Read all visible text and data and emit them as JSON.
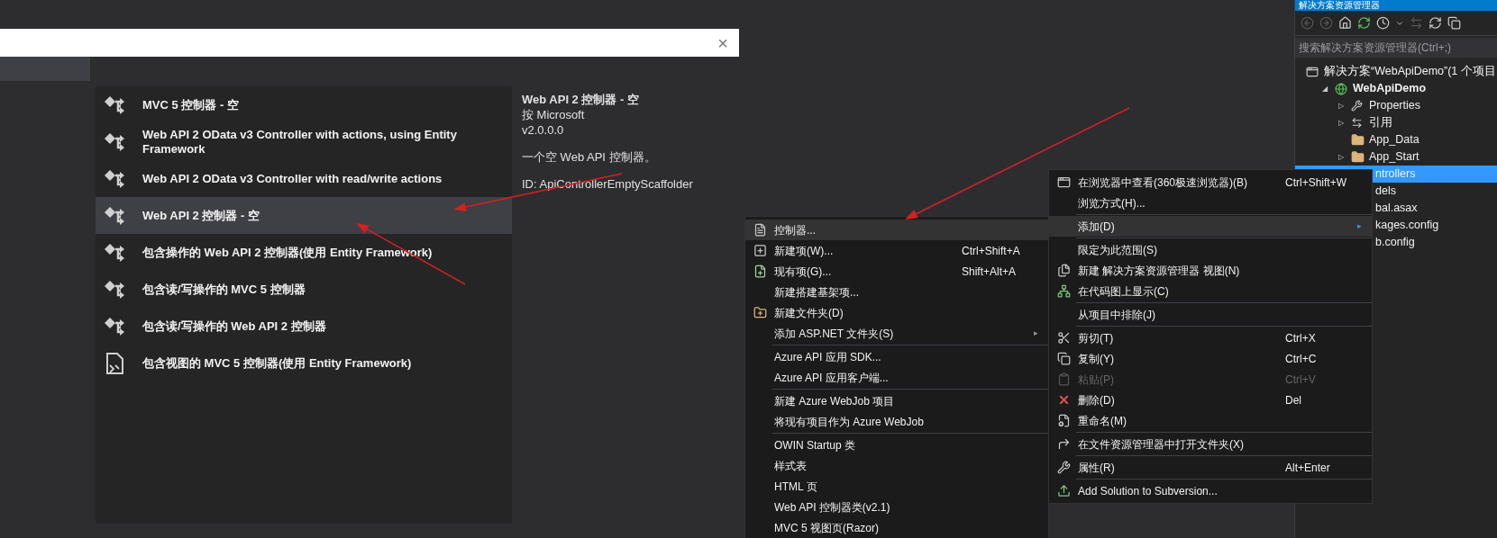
{
  "dialog": {
    "close": "×",
    "templates": [
      {
        "kind": "controller",
        "label": "MVC 5 控制器 - 空",
        "selected": false
      },
      {
        "kind": "controller",
        "label": "Web API 2 OData v3 Controller with actions, using Entity Framework",
        "selected": false
      },
      {
        "kind": "controller",
        "label": "Web API 2 OData v3 Controller with read/write actions",
        "selected": false
      },
      {
        "kind": "controller",
        "label": "Web API 2 控制器 - 空",
        "selected": true
      },
      {
        "kind": "controller",
        "label": "包含操作的 Web API 2 控制器(使用 Entity Framework)",
        "selected": false
      },
      {
        "kind": "controller",
        "label": "包含读/写操作的 MVC 5 控制器",
        "selected": false
      },
      {
        "kind": "controller",
        "label": "包含读/写操作的 Web API 2 控制器",
        "selected": false
      },
      {
        "kind": "document",
        "label": "包含视图的 MVC 5 控制器(使用 Entity Framework)",
        "selected": false
      }
    ],
    "details": {
      "title": "Web API 2 控制器 - 空",
      "publisher": "按 Microsoft",
      "version": "v2.0.0.0",
      "description": "一个空 Web API 控制器。",
      "id": "ID: ApiControllerEmptyScaffolder"
    }
  },
  "solution_explorer": {
    "title": "解决方案资源管理器",
    "search": {
      "placeholder": "搜索解决方案资源管理器(Ctrl+;)"
    },
    "tree": [
      {
        "kind": "solution",
        "label": "解决方案“WebApiDemo”(1 个项目",
        "children": [
          {
            "kind": "project",
            "label": "WebApiDemo",
            "expander": "◢",
            "children": [
              {
                "kind": "properties",
                "label": "Properties",
                "expander": "▷",
                "selected": false
              },
              {
                "kind": "references",
                "label": "引用",
                "expander": "▷",
                "selected": false
              },
              {
                "kind": "folder",
                "label": "App_Data",
                "selected": false
              },
              {
                "kind": "folder",
                "label": "App_Start",
                "expander": "▷",
                "selected": false
              },
              {
                "kind": "covered",
                "label": "ntrollers",
                "selected": true
              },
              {
                "kind": "covered",
                "label": "dels",
                "selected": false
              },
              {
                "kind": "covered",
                "label": "bal.asax",
                "selected": false
              },
              {
                "kind": "covered",
                "label": "kages.config",
                "selected": false
              },
              {
                "kind": "covered",
                "label": "b.config",
                "selected": false
              }
            ]
          }
        ]
      }
    ]
  },
  "context_menu": {
    "items": [
      {
        "kind": "item",
        "label": "在浏览器中查看(360极速浏览器)(B)",
        "shortcut": "Ctrl+Shift+W",
        "selected": false,
        "disabled": false
      },
      {
        "kind": "item",
        "label": "浏览方式(H)...",
        "selected": false,
        "disabled": false
      },
      {
        "kind": "separator"
      },
      {
        "kind": "item",
        "label": "添加(D)",
        "submenu_arrow": "▸",
        "selected": true,
        "disabled": false
      },
      {
        "kind": "separator"
      },
      {
        "kind": "item",
        "label": "限定为此范围(S)",
        "selected": false,
        "disabled": false
      },
      {
        "kind": "item",
        "label": "新建 解决方案资源管理器 视图(N)",
        "selected": false,
        "disabled": false
      },
      {
        "kind": "item",
        "label": "在代码图上显示(C)",
        "selected": false,
        "disabled": false
      },
      {
        "kind": "separator"
      },
      {
        "kind": "item",
        "label": "从项目中排除(J)",
        "selected": false,
        "disabled": false
      },
      {
        "kind": "separator"
      },
      {
        "kind": "item",
        "label": "剪切(T)",
        "shortcut": "Ctrl+X",
        "selected": false,
        "disabled": false
      },
      {
        "kind": "item",
        "label": "复制(Y)",
        "shortcut": "Ctrl+C",
        "selected": false,
        "disabled": false
      },
      {
        "kind": "item",
        "label": "粘贴(P)",
        "shortcut": "Ctrl+V",
        "selected": false,
        "disabled": true
      },
      {
        "kind": "item",
        "label": "删除(D)",
        "shortcut": "Del",
        "selected": false,
        "disabled": false
      },
      {
        "kind": "item",
        "label": "重命名(M)",
        "selected": false,
        "disabled": false
      },
      {
        "kind": "separator"
      },
      {
        "kind": "item",
        "label": "在文件资源管理器中打开文件夹(X)",
        "selected": false,
        "disabled": false
      },
      {
        "kind": "separator"
      },
      {
        "kind": "item",
        "label": "属性(R)",
        "shortcut": "Alt+Enter",
        "selected": false,
        "disabled": false
      },
      {
        "kind": "separator"
      },
      {
        "kind": "item",
        "label": "Add Solution to Subversion...",
        "selected": false,
        "disabled": false
      }
    ]
  },
  "add_submenu": {
    "items": [
      {
        "kind": "item",
        "label": "控制器...",
        "selected": true
      },
      {
        "kind": "item",
        "label": "新建项(W)...",
        "shortcut": "Ctrl+Shift+A",
        "selected": false
      },
      {
        "kind": "item",
        "label": "现有项(G)...",
        "shortcut": "Shift+Alt+A",
        "selected": false
      },
      {
        "kind": "item",
        "label": "新建搭建基架项...",
        "selected": false
      },
      {
        "kind": "item",
        "label": "新建文件夹(D)",
        "selected": false
      },
      {
        "kind": "item",
        "label": "添加 ASP.NET 文件夹(S)",
        "submenu_arrow": "▸",
        "selected": false
      },
      {
        "kind": "separator"
      },
      {
        "kind": "item",
        "label": "Azure API 应用 SDK...",
        "selected": false
      },
      {
        "kind": "item",
        "label": "Azure API 应用客户端...",
        "selected": false
      },
      {
        "kind": "separator"
      },
      {
        "kind": "item",
        "label": "新建 Azure WebJob 项目",
        "selected": false
      },
      {
        "kind": "item",
        "label": "将现有项目作为 Azure WebJob",
        "selected": false
      },
      {
        "kind": "separator"
      },
      {
        "kind": "item",
        "label": "OWIN Startup 类",
        "selected": false
      },
      {
        "kind": "item",
        "label": "样式表",
        "selected": false
      },
      {
        "kind": "item",
        "label": "HTML 页",
        "selected": false
      },
      {
        "kind": "item",
        "label": "Web API 控制器类(v2.1)",
        "selected": false
      },
      {
        "kind": "item",
        "label": "MVC 5 视图页(Razor)",
        "selected": false
      }
    ]
  }
}
